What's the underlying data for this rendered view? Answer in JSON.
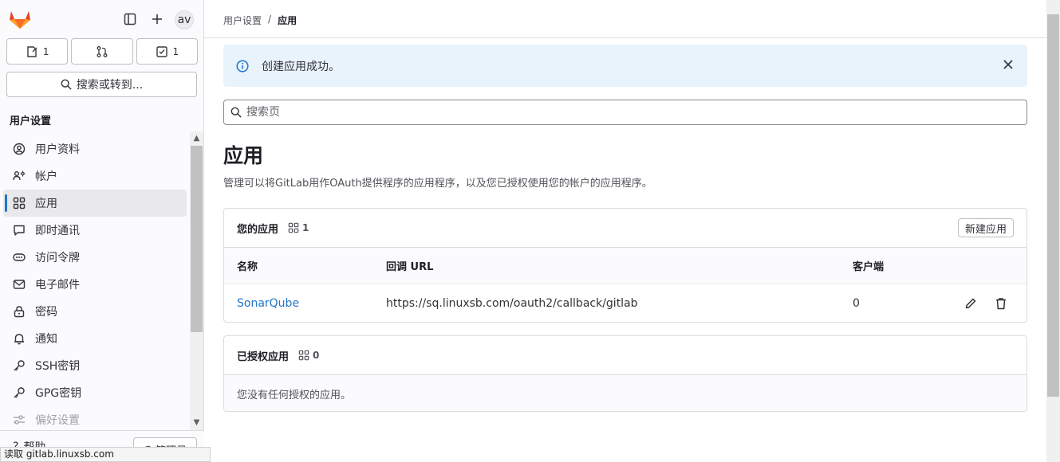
{
  "sidebar": {
    "avatar_text": "av",
    "counters": [
      {
        "icon": "issues-icon",
        "value": "1"
      },
      {
        "icon": "merge-request-icon",
        "value": ""
      },
      {
        "icon": "todo-icon",
        "value": "1"
      }
    ],
    "search_label": "搜索或转到...",
    "section_title": "用户设置",
    "items": [
      {
        "label": "用户资料",
        "icon": "profile-icon"
      },
      {
        "label": "帐户",
        "icon": "account-icon"
      },
      {
        "label": "应用",
        "icon": "applications-icon",
        "active": true
      },
      {
        "label": "即时通讯",
        "icon": "chat-icon"
      },
      {
        "label": "访问令牌",
        "icon": "token-icon"
      },
      {
        "label": "电子邮件",
        "icon": "mail-icon"
      },
      {
        "label": "密码",
        "icon": "lock-icon"
      },
      {
        "label": "通知",
        "icon": "bell-icon"
      },
      {
        "label": "SSH密钥",
        "icon": "key-icon"
      },
      {
        "label": "GPG密钥",
        "icon": "key-icon"
      },
      {
        "label": "偏好设置",
        "icon": "preferences-icon"
      }
    ],
    "help_label": "帮助",
    "admin_label": "管理员"
  },
  "statusbar": "读取 gitlab.linuxsb.com",
  "breadcrumb": {
    "parent": "用户设置",
    "separator": "/",
    "current": "应用"
  },
  "alert": {
    "message": "创建应用成功。"
  },
  "search": {
    "placeholder": "搜索页"
  },
  "page": {
    "title": "应用",
    "description": "管理可以将GitLab用作OAuth提供程序的应用程序，以及您已授权使用您的帐户的应用程序。"
  },
  "your_apps": {
    "title": "您的应用",
    "count": "1",
    "new_button": "新建应用",
    "columns": [
      "名称",
      "回调 URL",
      "客户端"
    ],
    "rows": [
      {
        "name": "SonarQube",
        "callback": "https://sq.linuxsb.com/oauth2/callback/gitlab",
        "clients": "0"
      }
    ]
  },
  "authorized_apps": {
    "title": "已授权应用",
    "count": "0",
    "empty": "您没有任何授权的应用。"
  },
  "colors": {
    "accent": "#1f75cb",
    "alert_bg": "#e9f3fc",
    "logo_orange": "#e24329"
  }
}
